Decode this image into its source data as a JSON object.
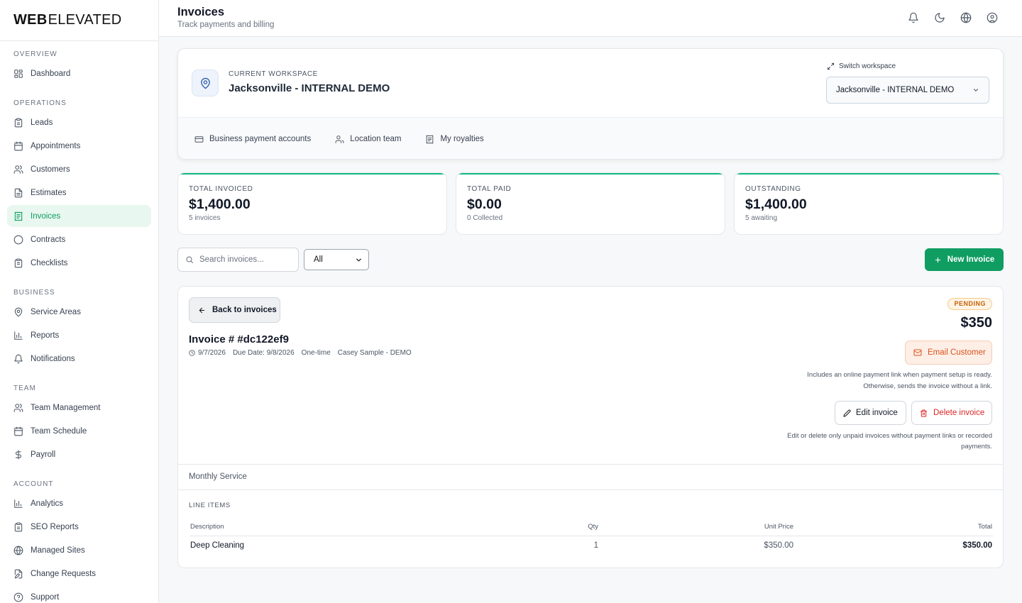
{
  "brand": {
    "part1": "WEB",
    "part2": "ELEVATED"
  },
  "sidebar": {
    "sections": [
      {
        "title": "OVERVIEW",
        "items": [
          {
            "label": "Dashboard",
            "icon": "dashboard-icon"
          }
        ]
      },
      {
        "title": "OPERATIONS",
        "items": [
          {
            "label": "Leads",
            "icon": "clipboard-icon"
          },
          {
            "label": "Appointments",
            "icon": "calendar-icon"
          },
          {
            "label": "Customers",
            "icon": "users-icon"
          },
          {
            "label": "Estimates",
            "icon": "document-icon"
          },
          {
            "label": "Invoices",
            "icon": "invoice-icon",
            "active": true
          },
          {
            "label": "Contracts",
            "icon": "circle-icon"
          },
          {
            "label": "Checklists",
            "icon": "checklist-icon"
          }
        ]
      },
      {
        "title": "BUSINESS",
        "items": [
          {
            "label": "Service Areas",
            "icon": "map-pin-icon"
          },
          {
            "label": "Reports",
            "icon": "bar-chart-icon"
          },
          {
            "label": "Notifications",
            "icon": "bell-icon"
          }
        ]
      },
      {
        "title": "TEAM",
        "items": [
          {
            "label": "Team Management",
            "icon": "users-icon"
          },
          {
            "label": "Team Schedule",
            "icon": "calendar-icon"
          },
          {
            "label": "Payroll",
            "icon": "dollar-icon"
          }
        ]
      },
      {
        "title": "ACCOUNT",
        "items": [
          {
            "label": "Analytics",
            "icon": "bar-chart-icon"
          },
          {
            "label": "SEO Reports",
            "icon": "clipboard-icon"
          },
          {
            "label": "Managed Sites",
            "icon": "globe-icon"
          },
          {
            "label": "Change Requests",
            "icon": "file-edit-icon"
          },
          {
            "label": "Support",
            "icon": "help-circle-icon"
          }
        ]
      }
    ]
  },
  "header": {
    "title": "Invoices",
    "subtitle": "Track payments and billing"
  },
  "workspace": {
    "label": "CURRENT WORKSPACE",
    "name": "Jacksonville - INTERNAL DEMO",
    "switch_label": "Switch workspace",
    "selected": "Jacksonville - INTERNAL DEMO",
    "links": [
      "Business payment accounts",
      "Location team",
      "My royalties"
    ]
  },
  "stats": [
    {
      "label": "TOTAL INVOICED",
      "value": "$1,400.00",
      "note": "5 invoices"
    },
    {
      "label": "TOTAL PAID",
      "value": "$0.00",
      "note": "0 Collected"
    },
    {
      "label": "OUTSTANDING",
      "value": "$1,400.00",
      "note": "5 awaiting"
    }
  ],
  "toolbar": {
    "search_placeholder": "Search invoices...",
    "filter_value": "All",
    "new_label": "New Invoice"
  },
  "invoice": {
    "back_label": "Back to invoices",
    "title": "Invoice # #dc122ef9",
    "date": "9/7/2026",
    "due": "Due Date: 9/8/2026",
    "type": "One-time",
    "customer": "Casey Sample - DEMO",
    "status": "PENDING",
    "amount": "$350",
    "email_label": "Email Customer",
    "email_help_1": "Includes an online payment link when payment setup is ready.",
    "email_help_2": "Otherwise, sends the invoice without a link.",
    "edit_label": "Edit invoice",
    "delete_label": "Delete invoice",
    "edit_help": "Edit or delete only unpaid invoices without payment links or recorded payments.",
    "description": "Monthly Service",
    "line_items_title": "LINE ITEMS",
    "columns": [
      "Description",
      "Qty",
      "Unit Price",
      "Total"
    ],
    "rows": [
      {
        "description": "Deep Cleaning",
        "qty": "1",
        "unit_price": "$350.00",
        "total": "$350.00"
      }
    ]
  },
  "colors": {
    "accent": "#0f9d62",
    "warning": "#c2620a",
    "danger": "#dc2626"
  }
}
